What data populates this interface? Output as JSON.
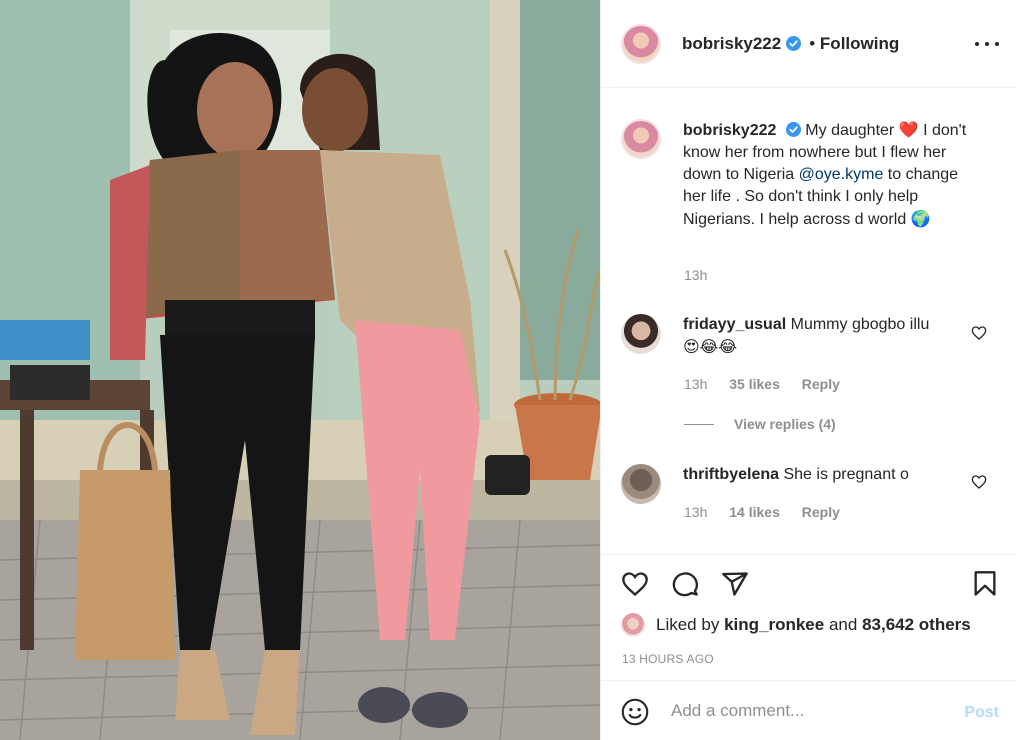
{
  "post": {
    "username": "bobrisky222",
    "follow_separator": "•",
    "follow_status": "Following"
  },
  "caption": {
    "username": "bobrisky222",
    "text_part1": "My daughter",
    "heart_emoji": "❤️",
    "text_part2": "I don't know her from nowhere but I flew her down to Nigeria",
    "mention": "@oye.kyme",
    "text_part3": "to change her life . So don't think I only help Nigerians. I help across d world",
    "globe_emoji": "🌍",
    "time": "13h"
  },
  "comments": [
    {
      "username": "fridayy_usual",
      "text": "Mummy gbogbo illu",
      "emojis": "😍😂😂",
      "time": "13h",
      "likes": "35 likes",
      "reply_label": "Reply",
      "view_replies": "View replies (4)"
    },
    {
      "username": "thriftbyelena",
      "text": "She is pregnant o",
      "time": "13h",
      "likes": "14 likes",
      "reply_label": "Reply"
    }
  ],
  "likes": {
    "prefix": "Liked by",
    "user": "king_ronkee",
    "and": "and",
    "others": "83,642 others"
  },
  "timestamp": "13 HOURS AGO",
  "add_comment": {
    "placeholder": "Add a comment...",
    "post_label": "Post"
  },
  "icons": {
    "verified": "verified-badge-icon",
    "more": "more-options-icon",
    "like": "heart-icon",
    "comment": "comment-icon",
    "share": "paper-plane-icon",
    "save": "bookmark-icon",
    "emoji": "smiley-icon"
  },
  "colors": {
    "verified_blue": "#3897f0",
    "mention_blue": "#00376b",
    "post_button_disabled": "#b3dbff",
    "muted_text": "#8e8e8e"
  }
}
